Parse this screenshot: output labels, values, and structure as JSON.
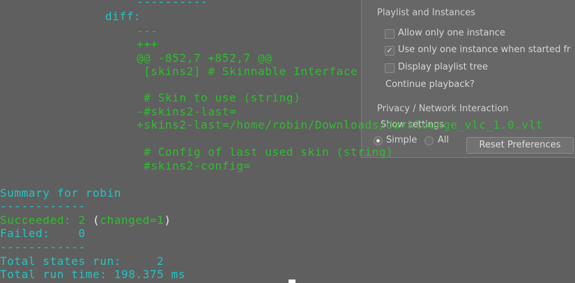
{
  "prefs": {
    "section_playlist": "Playlist and Instances",
    "options": [
      {
        "label": "Allow only one instance",
        "checked": false
      },
      {
        "label": "Use only one instance when started fr",
        "checked": true
      },
      {
        "label": "Display playlist tree",
        "checked": false
      }
    ],
    "continue_label": "Continue playback?",
    "section_privacy": "Privacy / Network Interaction",
    "show_settings_label": "Show settings",
    "radio_simple": "Simple",
    "radio_all": "All",
    "reset_button": "Reset Preferences"
  },
  "terminal": {
    "rule_top": "----------",
    "diff_label": "diff:",
    "minus_header": "---",
    "plus_header": "+++",
    "hunk": "@@ -852,7 +852,7 @@",
    "ctx1": " [skins2] # Skinnable Interface",
    "ctx2": " # Skin to use (string)",
    "removed": "-#skins2-last=",
    "added": "+skins2-last=/home/robin/Downloads/darklounge_vlc_1.0.vlt",
    "ctx3": " # Config of last used skin (string)",
    "ctx4": " #skins2-config=",
    "summary": "Summary for robin",
    "rule": "------------",
    "succeeded_label": "Succeeded: 2 ",
    "paren_open": "(",
    "changed": "changed=1",
    "paren_close": ")",
    "failed": "Failed:    0",
    "total_states": "Total states run:     2",
    "total_time": "Total run time: 198.375 ms"
  },
  "colors": {
    "background": "#5f5f5f",
    "green": "#2fbd2f",
    "cyan": "#25c3c3",
    "white": "#e8e8e8"
  }
}
